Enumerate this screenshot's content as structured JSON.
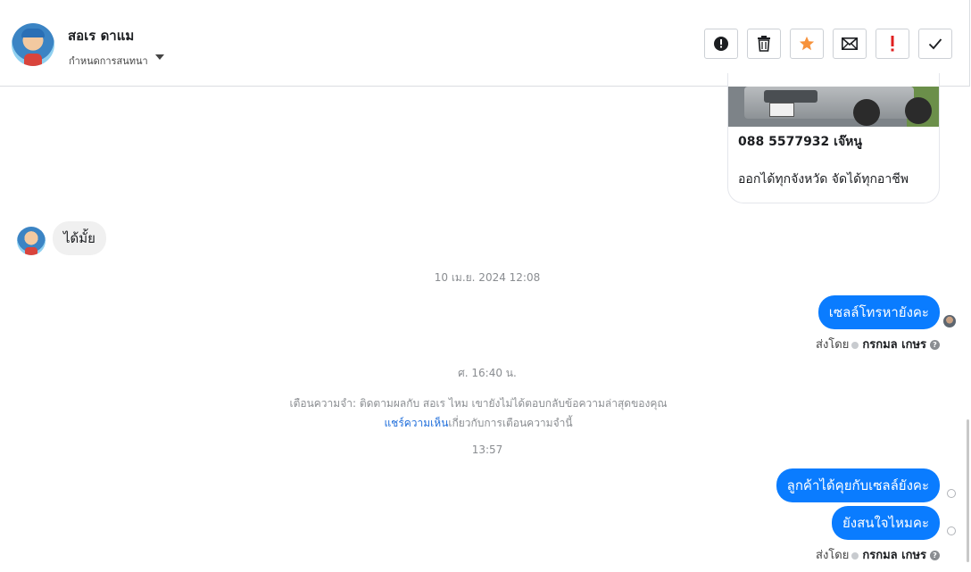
{
  "header": {
    "contact_name": "สอเร ดาแม",
    "assign_label": "กำหนดการสนทนา",
    "actions": [
      {
        "name": "report-button",
        "icon": "alert-circle-icon"
      },
      {
        "name": "delete-button",
        "icon": "trash-icon"
      },
      {
        "name": "star-button",
        "icon": "star-icon",
        "color": "#f7923b"
      },
      {
        "name": "mark-unread-button",
        "icon": "envelope-icon"
      },
      {
        "name": "important-button",
        "icon": "exclamation-icon",
        "color": "#e02020"
      },
      {
        "name": "done-button",
        "icon": "checkmark-icon"
      }
    ]
  },
  "thread": {
    "card": {
      "title": "088 5577932 เจ๊หนู",
      "text": "ออกได้ทุกจังหวัด จัดได้ทุกอาชีพ"
    },
    "incoming_1": "ได้มั้ย",
    "timestamp_1": "10 เม.ย. 2024 12:08",
    "outgoing_1": "เซลล์โทรหายังคะ",
    "sent_by_label": "ส่งโดย",
    "sent_by_name": "กรกมล เกษร",
    "timestamp_2": "ศ. 16:40 น.",
    "reminder_line1": "เตือนความจำ: ติดตามผลกับ สอเร ไหม เขายังไม่ได้ตอบกลับข้อความล่าสุดของคุณ",
    "reminder_link": "แชร์ความเห็น",
    "reminder_line2_rest": "เกี่ยวกับการเตือนความจำนี้",
    "timestamp_3": "13:57",
    "outgoing_2": "ลูกค้าได้คุยกับเซลล์ยังคะ",
    "outgoing_3": "ยังสนใจไหมคะ",
    "accent_color": "#0a7cff"
  }
}
